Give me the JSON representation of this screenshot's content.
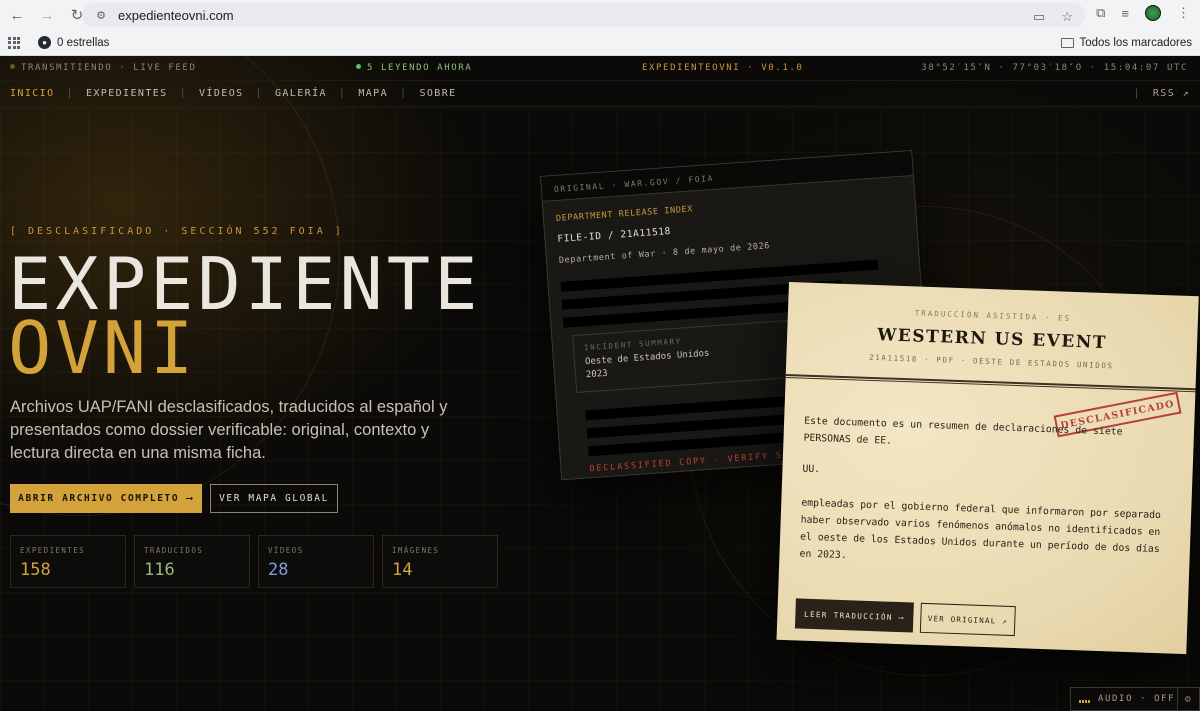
{
  "browser": {
    "url": "expedienteovni.com",
    "bookmarks": [
      {
        "label": "0 estrellas"
      }
    ],
    "all_bookmarks": "Todos los marcadores"
  },
  "topbar": {
    "live": "TRANSMITIENDO · LIVE FEED",
    "readers": "5 LEYENDO AHORA",
    "version": "EXPEDIENTEOVNI · V0.1.0",
    "coords": "38°52′15″N · 77°03′18″O · 15:04:07 UTC"
  },
  "nav": {
    "items": [
      "INICIO",
      "EXPEDIENTES",
      "VÍDEOS",
      "GALERÍA",
      "MAPA",
      "SOBRE"
    ],
    "rss": "RSS ↗"
  },
  "hero": {
    "kicker": "[ DESCLASIFICADO · SECCIÓN 552 FOIA ]",
    "title_line1": "EXPEDIENTE",
    "title_line2": "OVNI",
    "lede": "Archivos UAP/FANI desclasificados, traducidos al español y presentados como dossier verificable: original, contexto y lectura directa en una misma ficha.",
    "primary_cta": "ABRIR ARCHIVO COMPLETO ⟶",
    "secondary_cta": "VER MAPA GLOBAL"
  },
  "stats": [
    {
      "label": "EXPEDIENTES",
      "value": "158",
      "color": "#d4a23a"
    },
    {
      "label": "TRADUCIDOS",
      "value": "116",
      "color": "#8fbf7a"
    },
    {
      "label": "VÍDEOS",
      "value": "28",
      "color": "#7f9fd6"
    },
    {
      "label": "IMÁGENES",
      "value": "14",
      "color": "#d4a23a"
    }
  ],
  "original_doc": {
    "header": "ORIGINAL · WAR.GOV / FOIA",
    "index_title": "DEPARTMENT RELEASE INDEX",
    "file_id": "FILE-ID / 21A11518",
    "dept_date": "Department of War · 8 de mayo de 2026",
    "summary_title": "INCIDENT SUMMARY",
    "summary_line1": "Oeste de Estados Unidos",
    "summary_line2": "2023",
    "footer": "DECLASSIFIED COPY · VERIFY SOURCE ↗"
  },
  "translation_doc": {
    "label": "TRADUCCIÓN ASISTIDA · ES",
    "title": "WESTERN US EVENT",
    "meta": "21A11518 · PDF · OESTE DE ESTADOS UNIDOS",
    "stamp": "DESCLASIFICADO",
    "para1": "Este documento es un resumen de declaraciones de siete PERSONAS de EE.",
    "para2": "UU.",
    "para3": "empleadas por el gobierno federal que informaron por separado haber observado varios fenómenos anómalos no identificados en el oeste de los Estados Unidos durante un período de dos días en 2023.",
    "read_btn": "LEER TRADUCCIÓN ⟶",
    "orig_btn": "VER ORIGINAL ↗"
  },
  "audio": {
    "label": "AUDIO · OFF"
  },
  "colors": {
    "accent": "#d4a23a",
    "live_dot": "#c9973a",
    "readers_dot": "#5fbf6a",
    "stamp_red": "#b6403a"
  }
}
